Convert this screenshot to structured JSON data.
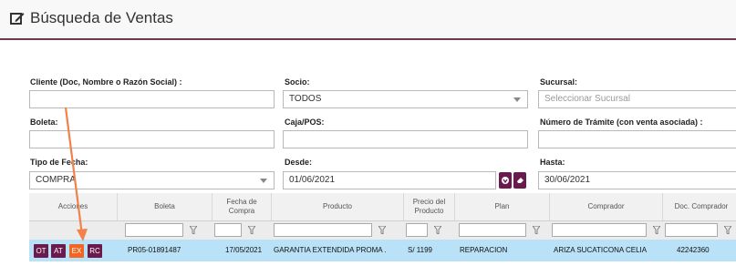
{
  "header": {
    "title": "Búsqueda de Ventas"
  },
  "form": {
    "cliente": {
      "label": "Cliente (Doc, Nombre o Razón Social) :",
      "value": ""
    },
    "socio": {
      "label": "Socio:",
      "value": "TODOS"
    },
    "sucursal": {
      "label": "Sucursal:",
      "placeholder": "Seleccionar Sucursal"
    },
    "boleta": {
      "label": "Boleta:",
      "value": ""
    },
    "caja": {
      "label": "Caja/POS:",
      "value": ""
    },
    "tramite": {
      "label": "Número de Trámite (con venta asociada) :",
      "value": ""
    },
    "tipo_fecha": {
      "label": "Tipo de Fecha:",
      "value": "COMPRA"
    },
    "desde": {
      "label": "Desde:",
      "value": "01/06/2021"
    },
    "hasta": {
      "label": "Hasta:",
      "value": "30/06/2021"
    }
  },
  "grid": {
    "headers": [
      "Acciones",
      "Boleta",
      "Fecha de Compra",
      "Producto",
      "Precio del Producto",
      "Plan",
      "Comprador",
      "Doc. Comprador"
    ],
    "row": {
      "actions": [
        "OT",
        "AT",
        "EX",
        "RC"
      ],
      "boleta": "PR05-01891487",
      "fecha": "17/05/2021",
      "producto": "GARANTIA EXTENDIDA PROMA .",
      "precio": "S/ 1199",
      "plan": "REPARACION",
      "comprador": "ARIZA SUCATICONA CELIA",
      "doc": "42242360"
    }
  },
  "colors": {
    "accent": "#6b1a4e",
    "highlight": "#f26522",
    "row_selected": "#b9e1f7"
  }
}
